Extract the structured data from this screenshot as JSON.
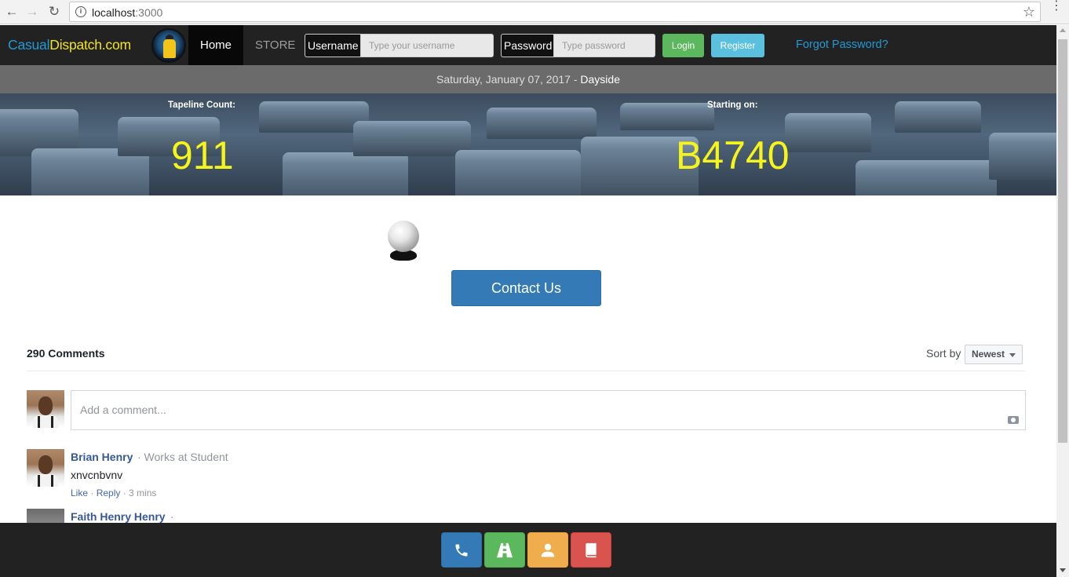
{
  "browser": {
    "url_host": "localhost",
    "url_port": ":3000"
  },
  "navbar": {
    "brand_part1": "Casual",
    "brand_part2": "Dispatch.com",
    "home_label": "Home",
    "store_label": "STORE",
    "username_label": "Username",
    "username_placeholder": "Type your username",
    "password_label": "Password",
    "password_placeholder": "Type password",
    "login_label": "Login",
    "register_label": "Register",
    "forgot_label": "Forgot Password?"
  },
  "datebar": {
    "date": "Saturday, January 07, 2017 - ",
    "shift": "Dayside"
  },
  "banner": {
    "tapeline_label": "Tapeline Count:",
    "tapeline_value": "911",
    "starting_label": "Starting on:",
    "starting_value": "B4740"
  },
  "main": {
    "contact_label": "Contact Us"
  },
  "comments": {
    "count_label": "290 Comments",
    "sort_label": "Sort by",
    "sort_value": "Newest",
    "input_placeholder": "Add a comment...",
    "items": [
      {
        "name": "Brian Henry",
        "work": "· Works at Student",
        "text": "xnvcnbvnv",
        "like": "Like",
        "reply": "Reply",
        "time": "· 3 mins"
      },
      {
        "name": "Faith Henry Henry",
        "work": "·"
      }
    ]
  },
  "bottom_bar": {
    "buttons": [
      "phone-icon",
      "road-icon",
      "user-icon",
      "book-icon"
    ],
    "colors": [
      "#337ab7",
      "#5cb85c",
      "#f0ad4e",
      "#d9534f"
    ]
  }
}
